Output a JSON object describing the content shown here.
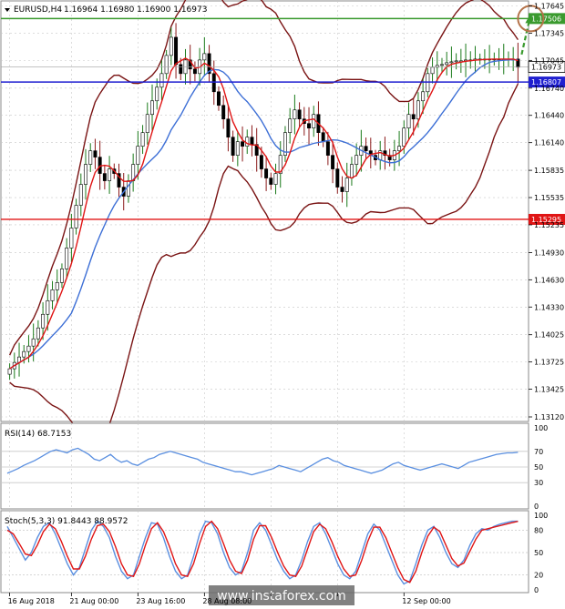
{
  "chart_data": [
    {
      "type": "candlestick",
      "title": "EURUSD,H4",
      "ohlc_header": "1.16964 1.16980 1.16900 1.16973",
      "ylim": [
        1.1312,
        1.1765
      ],
      "y_ticks": [
        "1.17645",
        "1.17345",
        "1.17045",
        "1.16740",
        "1.16440",
        "1.16140",
        "1.15835",
        "1.15535",
        "1.15235",
        "1.14930",
        "1.14630",
        "1.14330",
        "1.14025",
        "1.13725",
        "1.13425",
        "1.13120"
      ],
      "x_ticks": [
        "16 Aug 2018",
        "21 Aug 00:00",
        "23 Aug 16:00",
        "28 Aug 08:00",
        "",
        "",
        "12 Sep 00:00"
      ],
      "x_tick_index": [
        0,
        13,
        27,
        41,
        55,
        69,
        83
      ],
      "n_bars": 108,
      "close": [
        1.1365,
        1.1372,
        1.1378,
        1.1384,
        1.139,
        1.1398,
        1.141,
        1.1425,
        1.144,
        1.1452,
        1.146,
        1.1475,
        1.1498,
        1.152,
        1.1545,
        1.1568,
        1.159,
        1.1605,
        1.1598,
        1.158,
        1.1572,
        1.1585,
        1.158,
        1.1565,
        1.1555,
        1.1572,
        1.159,
        1.161,
        1.1625,
        1.1645,
        1.166,
        1.1675,
        1.169,
        1.171,
        1.173,
        1.17,
        1.169,
        1.1705,
        1.1695,
        1.169,
        1.1705,
        1.1712,
        1.169,
        1.167,
        1.1655,
        1.164,
        1.162,
        1.16,
        1.1615,
        1.161,
        1.162,
        1.1612,
        1.16,
        1.1585,
        1.1575,
        1.1568,
        1.158,
        1.16,
        1.1625,
        1.164,
        1.165,
        1.164,
        1.1635,
        1.163,
        1.1645,
        1.1625,
        1.1615,
        1.16,
        1.1585,
        1.1565,
        1.156,
        1.1575,
        1.159,
        1.16,
        1.161,
        1.1605,
        1.16,
        1.1595,
        1.1605,
        1.16,
        1.1595,
        1.1605,
        1.161,
        1.163,
        1.1645,
        1.164,
        1.166,
        1.167,
        1.169,
        1.1697,
        1.1699,
        1.17,
        1.1702,
        1.1703,
        1.1704,
        1.1704,
        1.1705,
        1.1705,
        1.1706,
        1.1706,
        1.1706,
        1.1706,
        1.1706,
        1.1706,
        1.1706,
        1.1706,
        1.1706,
        1.1697
      ],
      "levels": [
        {
          "value": 1.17506,
          "label": "1.17506",
          "color": "#3a9a2e"
        },
        {
          "value": 1.16807,
          "label": "1.16807",
          "color": "#1f1fd0"
        },
        {
          "value": 1.15295,
          "label": "1.15295",
          "color": "#e01515"
        }
      ],
      "current_price": {
        "value": 1.16973,
        "label": "1.16973"
      },
      "forecast": {
        "direction": "up",
        "color": "#3a9a2e",
        "target_circle_color": "#b5734a"
      }
    },
    {
      "type": "line",
      "title": "RSI(14) 68.7153",
      "ylim": [
        0,
        100
      ],
      "y_ticks": [
        "100",
        "70",
        "50",
        "30",
        "0"
      ],
      "values": [
        42,
        45,
        48,
        52,
        55,
        58,
        62,
        66,
        70,
        72,
        70,
        68,
        72,
        74,
        70,
        66,
        60,
        58,
        62,
        66,
        60,
        56,
        58,
        54,
        52,
        56,
        60,
        62,
        66,
        68,
        70,
        68,
        66,
        64,
        62,
        60,
        56,
        54,
        52,
        50,
        48,
        46,
        44,
        44,
        42,
        40,
        42,
        44,
        46,
        48,
        52,
        50,
        48,
        46,
        44,
        48,
        52,
        56,
        60,
        62,
        58,
        56,
        52,
        50,
        48,
        46,
        44,
        42,
        44,
        46,
        50,
        54,
        56,
        52,
        50,
        48,
        46,
        48,
        50,
        52,
        54,
        52,
        50,
        48,
        52,
        56,
        58,
        60,
        62,
        64,
        66,
        67,
        68,
        68,
        68.7
      ]
    },
    {
      "type": "line",
      "title": "Stoch(5,3,3) 91.8443 88.9572",
      "ylim": [
        0,
        100
      ],
      "y_ticks": [
        "100",
        "80",
        "50",
        "20",
        "0"
      ],
      "series": [
        {
          "values": [
            85,
            70,
            55,
            40,
            50,
            70,
            85,
            90,
            75,
            55,
            35,
            20,
            30,
            55,
            80,
            92,
            85,
            70,
            45,
            25,
            15,
            20,
            45,
            70,
            90,
            88,
            70,
            45,
            25,
            15,
            20,
            45,
            75,
            92,
            90,
            75,
            50,
            30,
            20,
            25,
            50,
            80,
            90,
            80,
            60,
            40,
            25,
            15,
            20,
            40,
            65,
            85,
            90,
            75,
            55,
            35,
            20,
            15,
            25,
            50,
            75,
            88,
            80,
            60,
            40,
            20,
            8,
            12,
            35,
            60,
            80,
            85,
            70,
            50,
            35,
            30,
            40,
            60,
            75,
            82,
            80,
            85,
            88,
            90,
            92,
            92
          ]
        },
        {
          "values": [
            80,
            75,
            62,
            48,
            46,
            60,
            78,
            88,
            82,
            65,
            45,
            28,
            28,
            45,
            68,
            86,
            88,
            78,
            58,
            35,
            20,
            18,
            35,
            60,
            82,
            90,
            78,
            58,
            35,
            20,
            18,
            35,
            62,
            85,
            92,
            82,
            62,
            40,
            25,
            22,
            40,
            68,
            86,
            86,
            70,
            50,
            32,
            20,
            18,
            32,
            55,
            78,
            88,
            82,
            65,
            45,
            28,
            18,
            20,
            40,
            65,
            84,
            84,
            70,
            50,
            30,
            14,
            10,
            25,
            50,
            72,
            84,
            78,
            60,
            42,
            32,
            36,
            52,
            68,
            80,
            82,
            84,
            86,
            88,
            90,
            91.8
          ]
        }
      ]
    }
  ],
  "watermark": "www.instaforex.com",
  "colors": {
    "bull": "#1a7a1a",
    "bear": "#8b1a1a",
    "bb": "#7a1414",
    "ma_fast": "#e01515",
    "ma_slow": "#3d6fd6",
    "grid": "#c8c8c8",
    "indicator_line": "#5a8fe0",
    "signal_line": "#e01515",
    "text": "#000000"
  }
}
